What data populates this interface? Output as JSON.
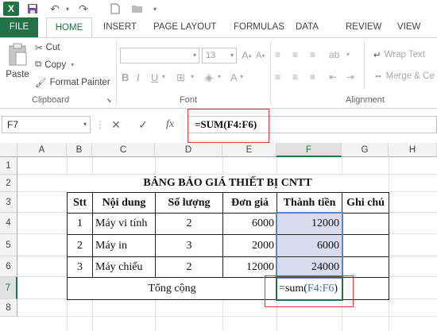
{
  "quick_access": {
    "app_icon": "excel-icon",
    "icons": [
      "save-icon",
      "undo-icon",
      "redo-icon",
      "new-file-icon",
      "open-folder-icon",
      "customize-icon"
    ]
  },
  "tabs": [
    "FILE",
    "HOME",
    "INSERT",
    "PAGE LAYOUT",
    "FORMULAS",
    "DATA",
    "REVIEW",
    "VIEW"
  ],
  "active_tab": "HOME",
  "ribbon": {
    "clipboard": {
      "paste": "Paste",
      "cut": "Cut",
      "copy": "Copy",
      "format_painter": "Format Painter",
      "label": "Clipboard"
    },
    "font": {
      "font_name": "",
      "font_size": "13",
      "bold": "B",
      "italic": "I",
      "underline": "U",
      "grow": "A",
      "shrink": "A",
      "font_color": "A",
      "label": "Font"
    },
    "alignment": {
      "wrap_text": "Wrap Text",
      "merge": "Merge & Ce",
      "label": "Alignment"
    }
  },
  "formula_bar": {
    "name_box": "F7",
    "cancel": "✕",
    "enter": "✓",
    "fx": "fx",
    "formula": "=SUM(F4:F6)"
  },
  "columns": [
    "A",
    "B",
    "C",
    "D",
    "E",
    "F",
    "G",
    "H"
  ],
  "rows": [
    "1",
    "2",
    "3",
    "4",
    "5",
    "6",
    "7",
    "8"
  ],
  "selected_column": "F",
  "selected_row": "7",
  "sheet": {
    "title": "BẢNG BÁO GIÁ THIẾT BỊ CNTT",
    "headers": [
      "Stt",
      "Nội dung",
      "Số lượng",
      "Đơn giá",
      "Thành tiền",
      "Ghi chú"
    ],
    "rows": [
      {
        "stt": "1",
        "item": "Máy vi tính",
        "qty": "2",
        "price": "6000",
        "total": "12000"
      },
      {
        "stt": "2",
        "item": "Máy in",
        "qty": "3",
        "price": "2000",
        "total": "6000"
      },
      {
        "stt": "3",
        "item": "Máy chiếu",
        "qty": "2",
        "price": "12000",
        "total": "24000"
      }
    ],
    "total_label": "Tổng cộng",
    "sum_prefix": "=sum(",
    "sum_ref": "F4:F6",
    "sum_suffix": ")"
  },
  "colors": {
    "excel_green": "#217346",
    "highlight_red": "#e03c3c",
    "range_blue": "#5b84c4",
    "range_fill": "#d8dcec"
  }
}
